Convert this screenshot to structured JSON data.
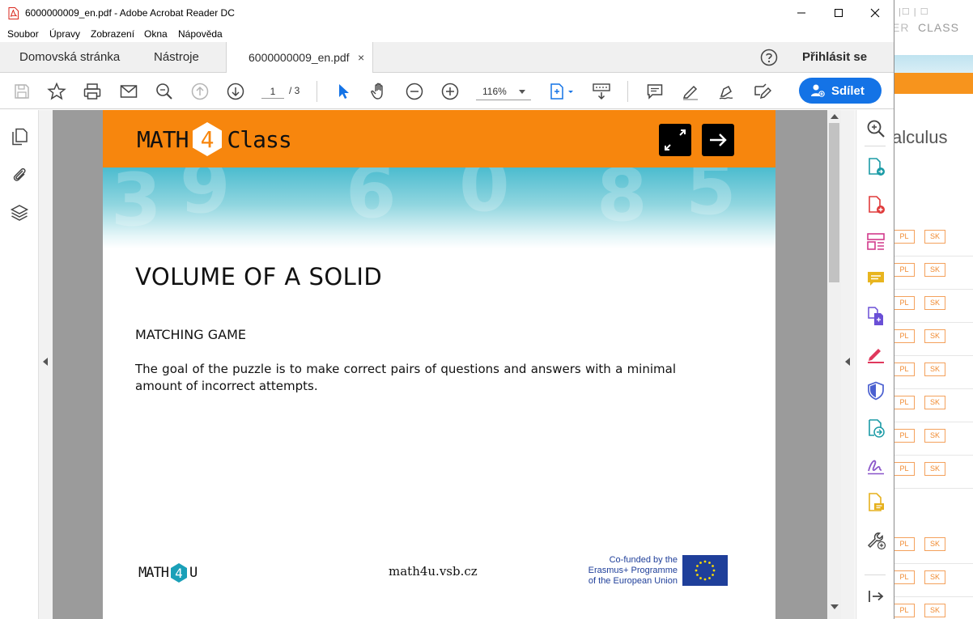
{
  "window": {
    "title": "6000000009_en.pdf - Adobe Acrobat Reader DC"
  },
  "menu": [
    "Soubor",
    "Úpravy",
    "Zobrazení",
    "Okna",
    "Nápověda"
  ],
  "tabs": {
    "home": "Domovská stránka",
    "tools": "Nástroje",
    "document": "6000000009_en.pdf",
    "close_glyph": "×",
    "signin": "Přihlásit se"
  },
  "toolbar": {
    "page_current": "1",
    "page_total": "/ 3",
    "zoom": "116%",
    "share_label": "Sdílet"
  },
  "pdf_page": {
    "logo_left": "MATH",
    "logo_number": "4",
    "logo_right": "Class",
    "title": "VOLUME OF A SOLID",
    "subtitle": "MATCHING GAME",
    "paragraph": "The goal of the puzzle is to make correct pairs of questions and answers with a minimal amount of incorrect attempts.",
    "footer_logo_left": "MATH",
    "footer_logo_number": "4",
    "footer_logo_right": "U",
    "footer_url": "math4u.vsb.cz",
    "eu_line1": "Co-funded by the",
    "eu_line2": "Erasmus+ Programme",
    "eu_line3": "of the European Union"
  },
  "background_site": {
    "top_links": "|☐ | ☐",
    "er_fragment": "ER",
    "class_link": "CLASS",
    "heading_fragment": "alculus",
    "badges_pl": "PL",
    "badges_sk": "SK"
  },
  "colors": {
    "accent_blue": "#1473e6",
    "banner_orange": "#f7860d",
    "eu_blue": "#1f3f9a"
  }
}
